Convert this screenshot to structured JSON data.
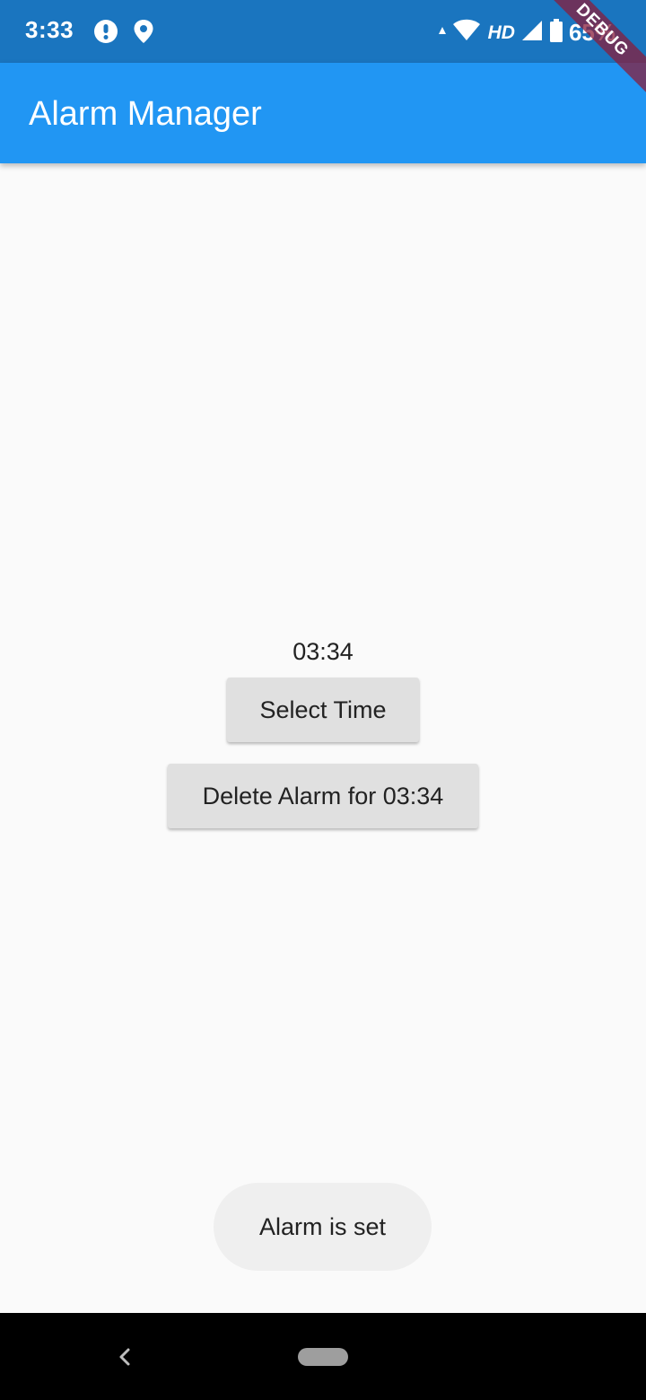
{
  "status_bar": {
    "time": "3:33",
    "left_icons": [
      "alert-icon",
      "location-pin-icon"
    ],
    "network_label": "HD",
    "battery_percent": "65%"
  },
  "debug_banner": {
    "label": "DEBUG"
  },
  "app_bar": {
    "title": "Alarm Manager",
    "color": "#2196f3"
  },
  "main": {
    "selected_time": "03:34",
    "select_time_button": "Select Time",
    "delete_alarm_button": "Delete Alarm for 03:34"
  },
  "toast": {
    "message": "Alarm is set"
  },
  "nav_bar": {
    "icons": [
      "back-icon",
      "home-pill-icon"
    ]
  }
}
